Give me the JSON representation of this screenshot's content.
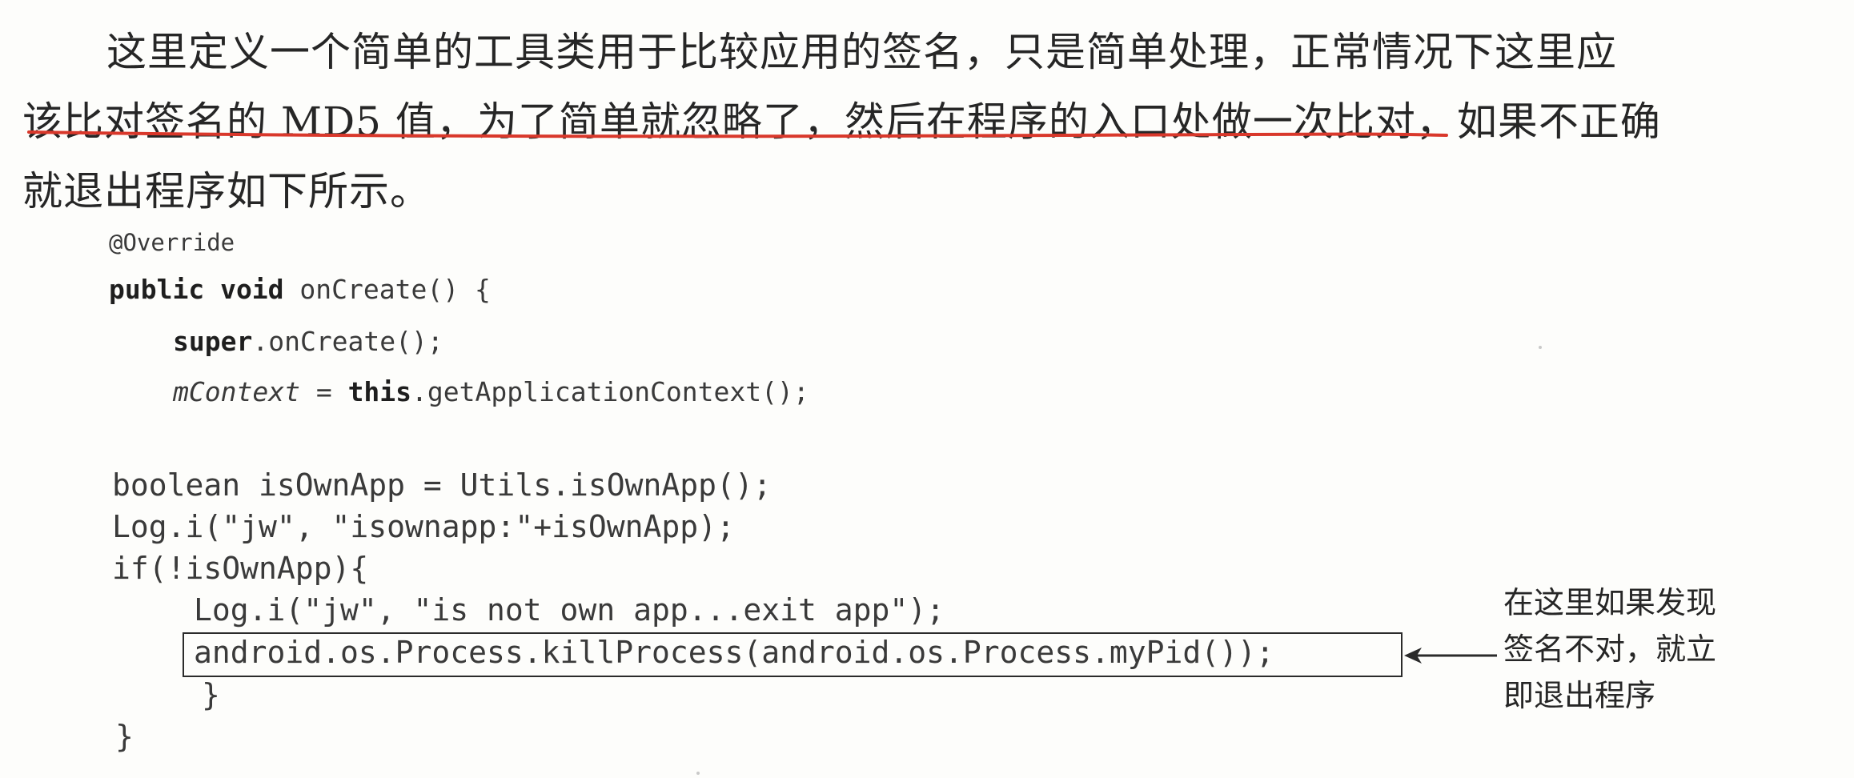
{
  "paragraph": {
    "lines": [
      "这里定义一个简单的工具类用于比较应用的签名，只是简单处理，正常情况下这里应",
      "该比对签名的 MD5 值，为了简单就忽略了，然后在程序的入口处做一次比对，如果不正确",
      "就退出程序如下所示。"
    ]
  },
  "code": {
    "annotation": "@Override",
    "l2": {
      "kw1": "public void",
      "rest": " onCreate() {"
    },
    "l3": {
      "kw": "super",
      "rest": ".onCreate();"
    },
    "l4": {
      "var": "mContext",
      "op": " = ",
      "kw": "this",
      "rest": ".getApplicationContext();"
    },
    "l5": "boolean isOwnApp = Utils.isOwnApp();",
    "l6": "Log.i(\"jw\", \"isownapp:\"+isOwnApp);",
    "l7": "if(!isOwnApp){",
    "l8": "Log.i(\"jw\", \"is not own app...exit app\");",
    "l9": "android.os.Process.killProcess(android.os.Process.myPid());",
    "l10": "}",
    "l11": "}"
  },
  "note": {
    "lines": [
      "在这里如果发现",
      "签名不对，就立",
      "即退出程序"
    ]
  },
  "colors": {
    "underline": "#d9382b",
    "text": "#262626",
    "box": "#2b2b2b"
  }
}
